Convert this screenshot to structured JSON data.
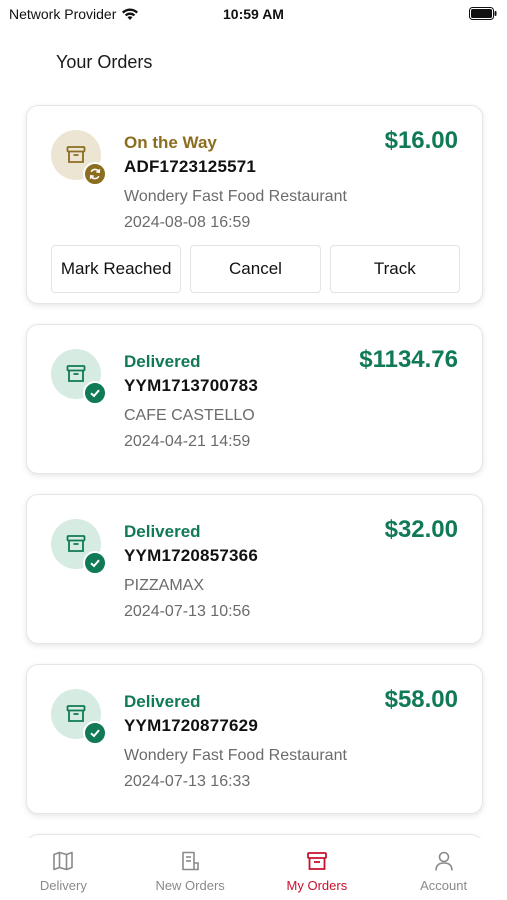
{
  "status_bar": {
    "carrier": "Network Provider",
    "time": "10:59 AM"
  },
  "page": {
    "title": "Your Orders"
  },
  "colors": {
    "delivered": "#0f7a55",
    "on_the_way": "#8a6d1f",
    "active_tab": "#c8102e",
    "inactive_tab": "#8a8a8a"
  },
  "orders": [
    {
      "status": "On the Way",
      "order_id": "ADF1723125571",
      "restaurant": "Wondery Fast Food Restaurant",
      "datetime": "2024-08-08 16:59",
      "amount": "$16.00",
      "icon": "box-icon",
      "badge_icon": "refresh-icon",
      "actions": {
        "mark_reached": "Mark Reached",
        "cancel": "Cancel",
        "track": "Track"
      }
    },
    {
      "status": "Delivered",
      "order_id": "YYM1713700783",
      "restaurant": "CAFE CASTELLO",
      "datetime": "2024-04-21 14:59",
      "amount": "$1134.76",
      "icon": "box-icon",
      "badge_icon": "check-icon"
    },
    {
      "status": "Delivered",
      "order_id": "YYM1720857366",
      "restaurant": "PIZZAMAX",
      "datetime": "2024-07-13 10:56",
      "amount": "$32.00",
      "icon": "box-icon",
      "badge_icon": "check-icon"
    },
    {
      "status": "Delivered",
      "order_id": "YYM1720877629",
      "restaurant": "Wondery Fast Food Restaurant",
      "datetime": "2024-07-13 16:33",
      "amount": "$58.00",
      "icon": "box-icon",
      "badge_icon": "check-icon"
    }
  ],
  "tabs": [
    {
      "label": "Delivery",
      "icon": "map-icon",
      "active": false
    },
    {
      "label": "New Orders",
      "icon": "receipt-icon",
      "active": false
    },
    {
      "label": "My Orders",
      "icon": "archive-box-icon",
      "active": true
    },
    {
      "label": "Account",
      "icon": "person-icon",
      "active": false
    }
  ]
}
